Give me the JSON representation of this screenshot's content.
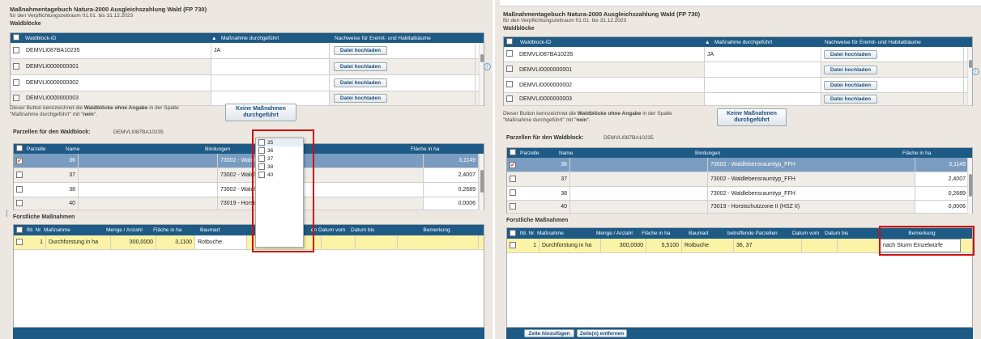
{
  "header": {
    "title": "Maßnahmentagebuch Natura-2000 Ausgleichszahlung Wald (FP 730)",
    "subtitle": "für den Verpflichtungszeitraum 01.01. bis 31.12.2023",
    "section": "Waldblöcke"
  },
  "waldbloecke": {
    "columns": [
      "Waldblock-ID",
      "Maßnahme durchgeführt",
      "Nachweise für Eremit- und Habitatbäume"
    ],
    "sort_icon": "▲",
    "upload_label": "Datei hochladen",
    "rows": [
      {
        "id": "DEMVLI087BA10235",
        "done": "JA"
      },
      {
        "id": "DEMVLI0000000001",
        "done": ""
      },
      {
        "id": "DEMVLI0000000002",
        "done": ""
      },
      {
        "id": "DEMVLI0000000003",
        "done": ""
      }
    ]
  },
  "no_action": {
    "text_pre": "Dieser Button kennzeichnet die ",
    "text_bold": "Waldblöcke ohne Angabe",
    "text_post": " in der Spalte",
    "text_line2_pre": "\"Maßnahme durchgeführt\" mit \"",
    "text_line2_bold": "nein",
    "text_line2_post": "\".",
    "button_line1": "Keine Maßnahmen",
    "button_line2": "durchgeführt"
  },
  "parzellen": {
    "label": "Parzellen für den Waldblock:",
    "waldblock": "DEMVLI087BA10235",
    "columns": [
      "Parzelle",
      "Name",
      "Bindungen",
      "Fläche in ha"
    ],
    "rows_left": [
      {
        "nr": "36",
        "bindung": "73002 - Waldleben",
        "flaeche": "3,1149",
        "checked": true
      },
      {
        "nr": "37",
        "bindung": "73002 - Waldleben",
        "flaeche": "2,4007",
        "checked": false
      },
      {
        "nr": "38",
        "bindung": "73002 - Waldleben",
        "flaeche": "0,2689",
        "checked": false
      },
      {
        "nr": "40",
        "bindung": "73019 - Horstschutz",
        "flaeche": "0,0006",
        "checked": false
      }
    ],
    "rows_right": [
      {
        "nr": "36",
        "bindung": "73002 - Waldlebensraumtyp_FFH",
        "flaeche": "3,1149",
        "checked": true
      },
      {
        "nr": "37",
        "bindung": "73002 - Waldlebensraumtyp_FFH",
        "flaeche": "2,4007",
        "checked": false
      },
      {
        "nr": "38",
        "bindung": "73002 - Waldlebensraumtyp_FFH",
        "flaeche": "0,2689",
        "checked": false
      },
      {
        "nr": "40",
        "bindung": "73019 - Horstschutzzone II (HSZ II)",
        "flaeche": "0,0006",
        "checked": false
      }
    ]
  },
  "massnahmen": {
    "section": "Forstliche Maßnahmen",
    "columns_left": [
      "lfd. Nr.",
      "Maßnahme",
      "Menge / Anzahl",
      "Fläche in ha",
      "Baumart",
      "",
      "Datum vom",
      "Datum bis",
      "Bemerkung"
    ],
    "columns_left_partial": "en",
    "columns_right": [
      "lfd. Nr.",
      "Maßnahme",
      "Menge / Anzahl",
      "Fläche in ha",
      "Baumart",
      "betreffende Parzellen",
      "Datum vom",
      "Datum bis",
      "Bemerkung"
    ],
    "row_left": {
      "nr": "1",
      "massnahme": "Durchforstung in ha",
      "menge": "300,0000",
      "flaeche": "3,1100",
      "baumart": "Rotbuche"
    },
    "row_right": {
      "nr": "1",
      "massnahme": "Durchforstung in ha",
      "menge": "300,0000",
      "flaeche": "5,5100",
      "baumart": "Rotbuche",
      "parzellen": "36, 37",
      "bemerkung": "nach Sturm Einzelwürfe"
    },
    "add_row": "Zeile hinzufügen",
    "remove_row": "Zeile(n) entfernen"
  },
  "dropdown": {
    "options": [
      "35",
      "36",
      "37",
      "38",
      "40"
    ]
  },
  "icons": {
    "info": "i",
    "left_marker": "|"
  },
  "colors": {
    "header_blue": "#1d5a86",
    "highlight": "#d01010",
    "row_selected": "#7a9cc0",
    "row_yellow": "#fbf3a6"
  }
}
